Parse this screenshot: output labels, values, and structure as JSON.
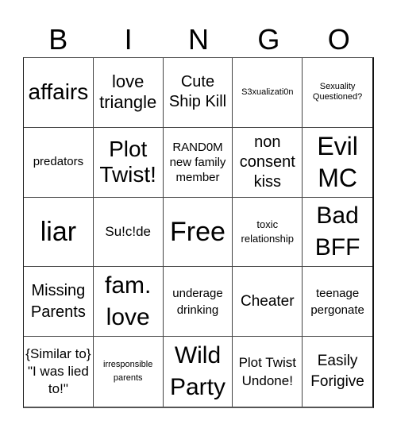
{
  "title_letters": [
    "B",
    "I",
    "N",
    "G",
    "O"
  ],
  "cells": [
    "affairs",
    "love triangle",
    "Cute Ship Kill",
    "S3xualizati0n",
    "Sexuality Questioned?",
    "predators",
    "Plot Twist!",
    "RAND0M new family member",
    "non consent kiss",
    "Evil MC",
    "liar",
    "Su!c!de",
    "Free",
    "toxic relationship",
    "Bad BFF",
    "Missing Parents",
    "fam. love",
    "underage drinking",
    "Cheater",
    "teenage pergonate",
    "{Similar to} \"I was lied to!\"",
    "irresponsible parents",
    "Wild Party",
    "Plot Twist Undone!",
    "Easily Forigive"
  ]
}
